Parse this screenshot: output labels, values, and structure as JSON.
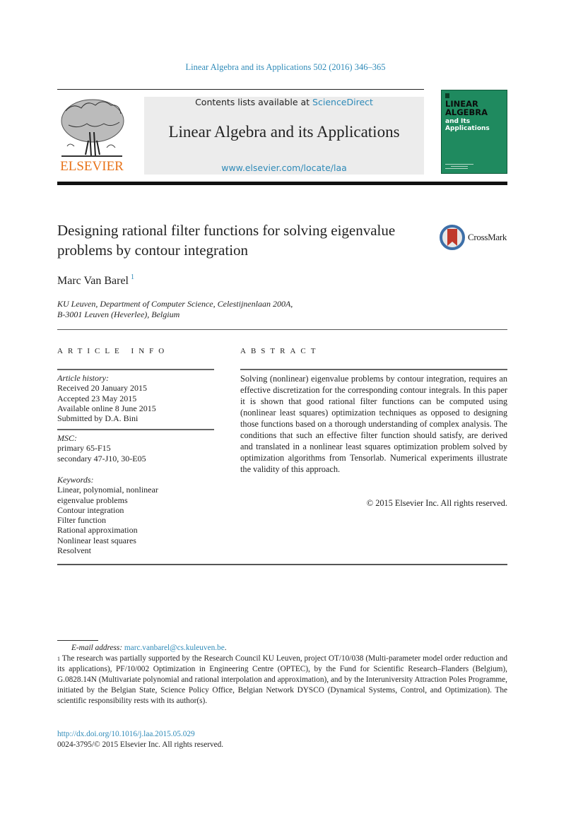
{
  "header": {
    "journal_reference": "Linear Algebra and its Applications 502 (2016) 346–365",
    "contents_prefix": "Contents lists available at ",
    "contents_link": "ScienceDirect",
    "journal_name": "Linear Algebra and its Applications",
    "journal_url": "www.elsevier.com/locate/laa",
    "publisher_logo_text": "ELSEVIER",
    "cover": {
      "title_line1": "LINEAR",
      "title_line2": "ALGEBRA",
      "subtitle_line1": "and Its",
      "subtitle_line2": "Applications",
      "color": "#1f8a5f"
    },
    "accent_color": "#2e8ab8",
    "logo_color": "#e8731a"
  },
  "article": {
    "title": "Designing rational filter functions for solving eigenvalue problems by contour integration",
    "crossmark_label": "CrossMark",
    "author": "Marc Van Barel",
    "author_footnote_mark": "1",
    "affiliation_line1": "KU Leuven, Department of Computer Science, Celestijnenlaan 200A,",
    "affiliation_line2": "B-3001 Leuven (Heverlee), Belgium"
  },
  "article_info": {
    "heading": "ARTICLE INFO",
    "history_label": "Article history:",
    "history": [
      "Received 20 January 2015",
      "Accepted 23 May 2015",
      "Available online 8 June 2015",
      "Submitted by D.A. Bini"
    ],
    "msc_label": "MSC:",
    "msc": [
      "primary 65-F15",
      "secondary 47-J10, 30-E05"
    ],
    "keywords_label": "Keywords:",
    "keywords": [
      "Linear, polynomial, nonlinear eigenvalue problems",
      "Contour integration",
      "Filter function",
      "Rational approximation",
      "Nonlinear least squares",
      "Resolvent"
    ]
  },
  "abstract": {
    "heading": "ABSTRACT",
    "text": "Solving (nonlinear) eigenvalue problems by contour integra­tion, requires an effective discretization for the corresponding contour integrals. In this paper it is shown that good rational filter functions can be computed using (nonlinear least squares) optimization techniques as opposed to designing those functions based on a thorough understanding of complex analysis. The conditions that such an effective filter function should satisfy, are derived and translated in a nonlinear least squares optimization problem solved by optimization algorithms from Tensorlab. Numerical experiments illustrate the validity of this approach.",
    "copyright": "© 2015 Elsevier Inc. All rights reserved."
  },
  "footnotes": {
    "email_label": "E-mail address:",
    "email": "marc.vanbarel@cs.kuleuven.be",
    "email_suffix": ".",
    "note_mark": "1",
    "note_text": "The research was partially supported by the Research Council KU Leuven, project OT/10/038 (Multi-parameter model order reduction and its applications), PF/10/002 Optimization in Engineering Centre (OPTEC), by the Fund for Scientific Research–Flanders (Belgium), G.0828.14N (Multivariate polynomial and rational interpolation and approximation), and by the Interuniversity Attraction Poles Programme, initiated by the Belgian State, Science Policy Office, Belgian Network DYSCO (Dynamical Systems, Control, and Optimization). The scientific responsibility rests with its author(s)."
  },
  "footer": {
    "doi": "http://dx.doi.org/10.1016/j.laa.2015.05.029",
    "issn_copyright": "0024-3795/© 2015 Elsevier Inc. All rights reserved."
  }
}
